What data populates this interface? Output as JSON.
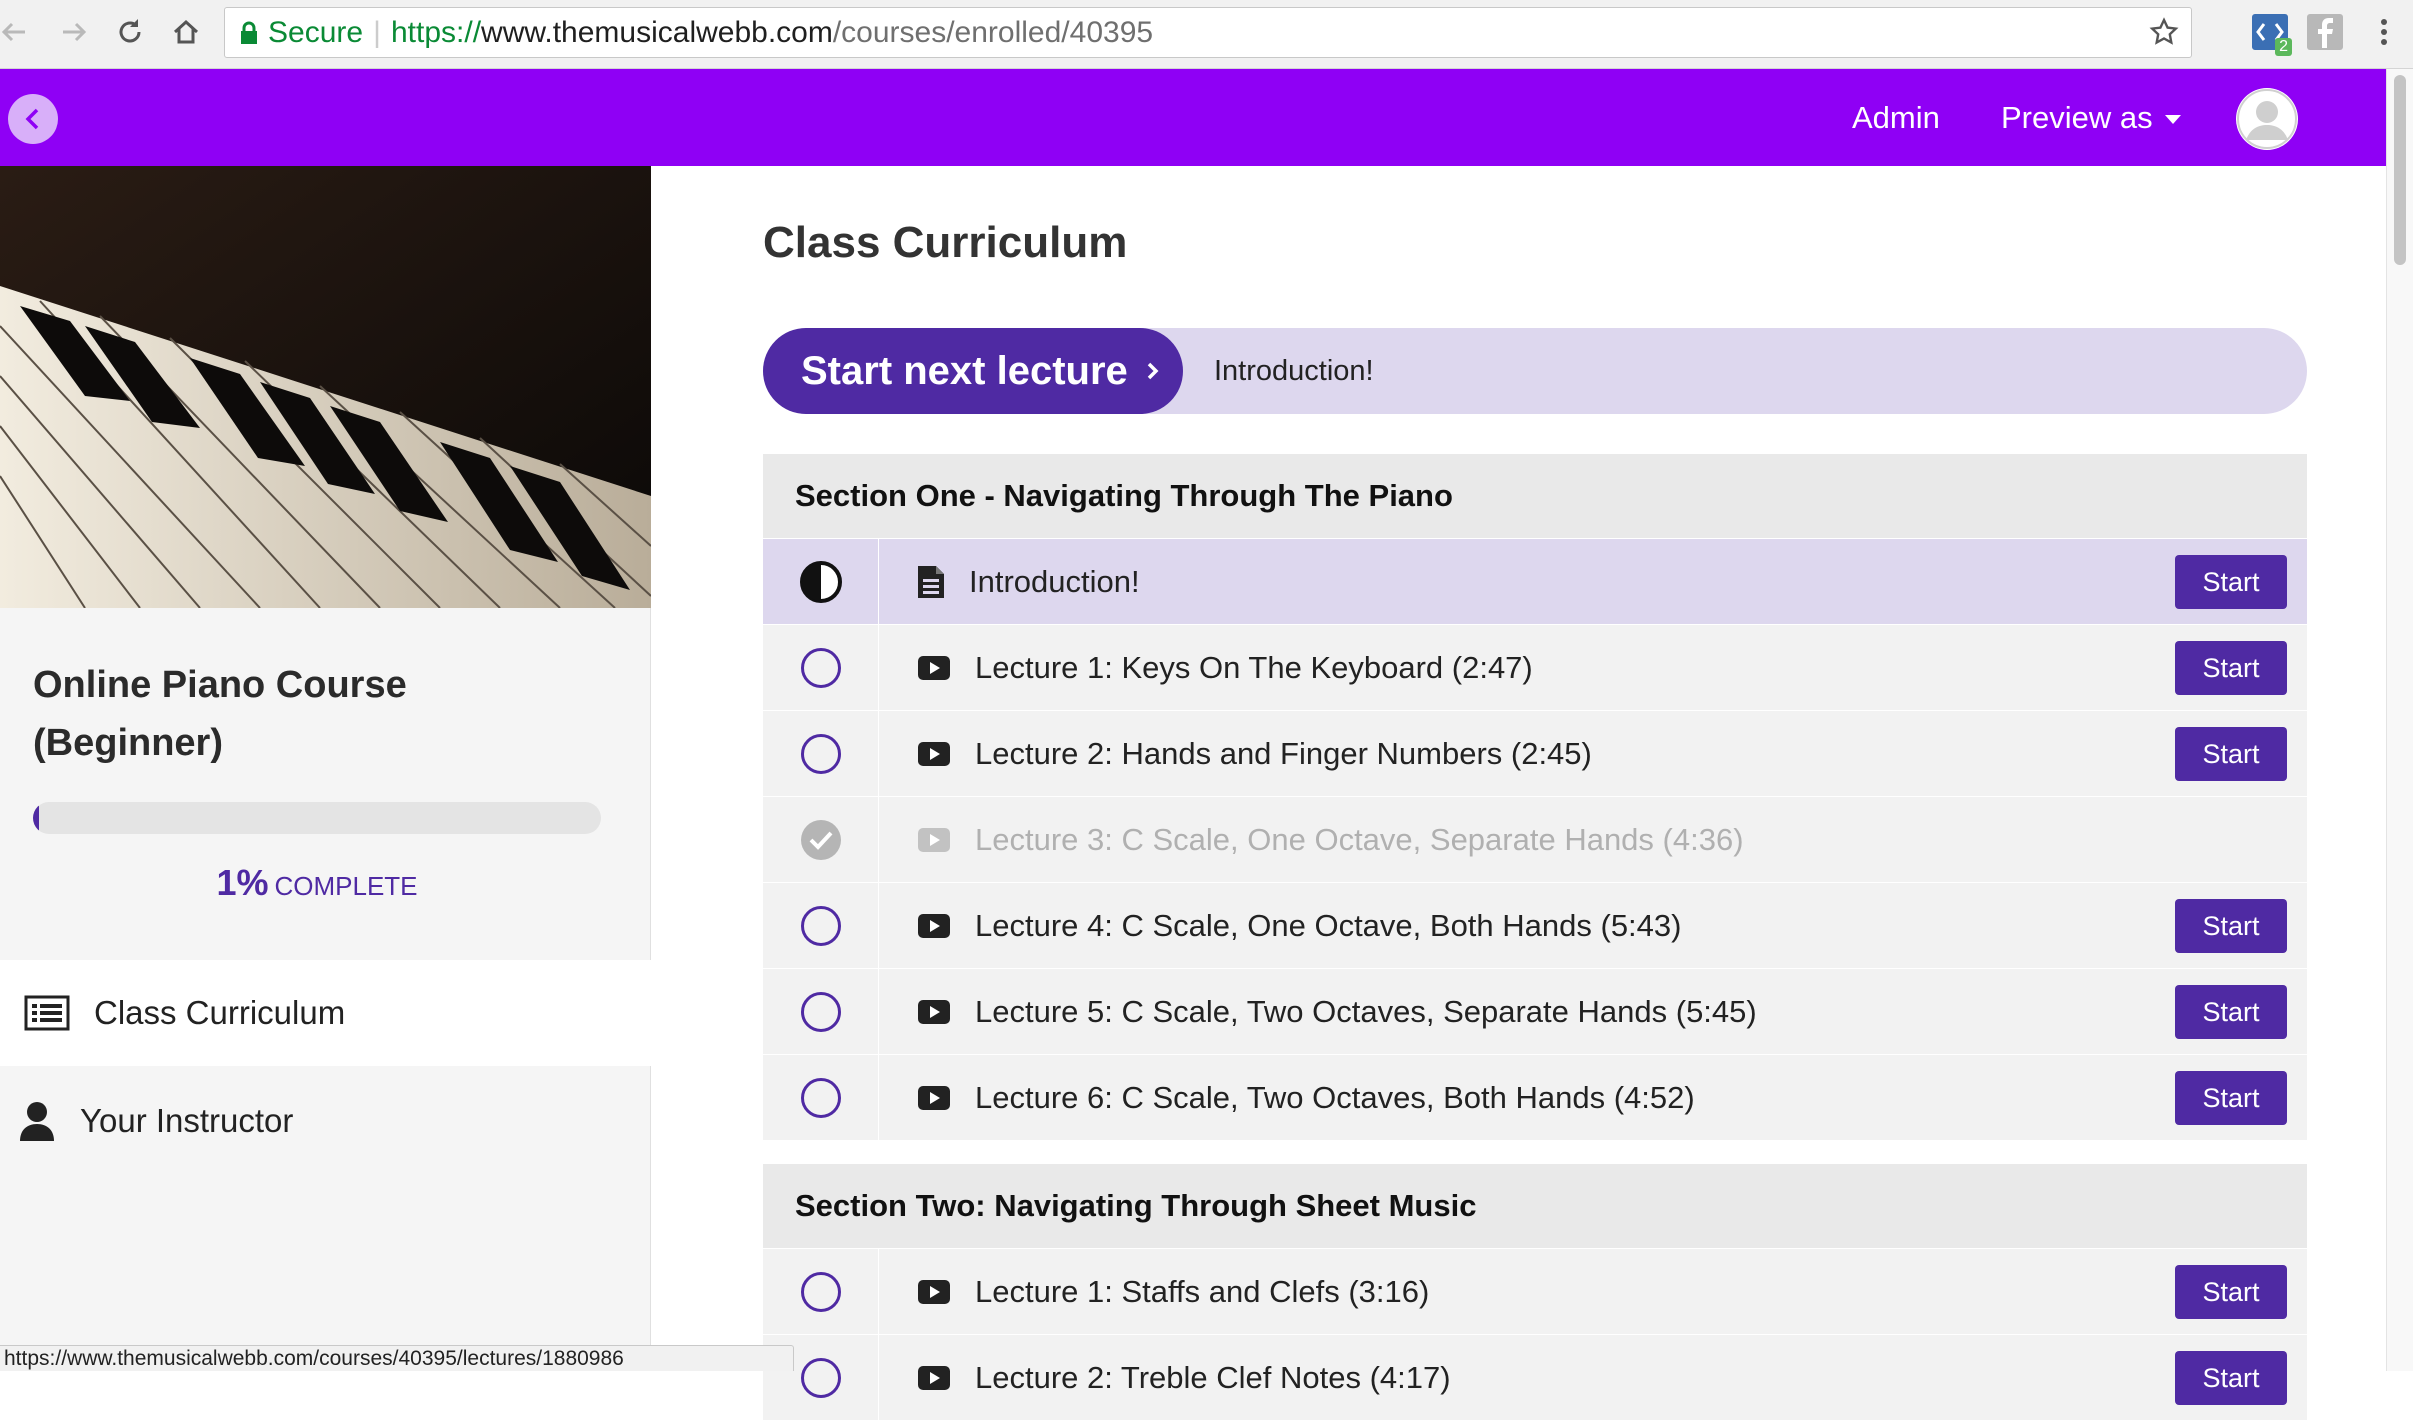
{
  "browser": {
    "secure_label": "Secure",
    "url_scheme": "https://",
    "url_host": "www.themusicalwebb.com",
    "url_path": "/courses/enrolled/40395",
    "extension_badge": "2",
    "status_url": "https://www.themusicalwebb.com/courses/40395/lectures/1880986"
  },
  "topbar": {
    "admin_label": "Admin",
    "preview_label": "Preview as",
    "accent_color": "#8f00f5"
  },
  "sidebar": {
    "course_title": "Online Piano Course (Beginner)",
    "progress_percent": 1,
    "progress_value": "1%",
    "progress_suffix": "COMPLETE",
    "nav": [
      {
        "label": "Class Curriculum",
        "icon": "list-icon",
        "active": true
      },
      {
        "label": "Your Instructor",
        "icon": "user-icon",
        "active": false
      }
    ]
  },
  "main": {
    "page_title": "Class Curriculum",
    "next_button_label": "Start next lecture",
    "next_lecture_title": "Introduction!",
    "brand_color": "#4f2aa3",
    "start_label": "Start",
    "sections": [
      {
        "title": "Section One - Navigating Through The Piano",
        "lectures": [
          {
            "title": "Introduction!",
            "type": "document-icon",
            "status": "in-progress"
          },
          {
            "title": "Lecture 1: Keys On The Keyboard (2:47)",
            "type": "video-icon",
            "status": "not-started"
          },
          {
            "title": "Lecture 2: Hands and Finger Numbers (2:45)",
            "type": "video-icon",
            "status": "not-started"
          },
          {
            "title": "Lecture 3: C Scale, One Octave, Separate Hands (4:36)",
            "type": "video-icon",
            "status": "completed"
          },
          {
            "title": "Lecture 4: C Scale, One Octave, Both Hands (5:43)",
            "type": "video-icon",
            "status": "not-started"
          },
          {
            "title": "Lecture 5: C Scale, Two Octaves, Separate Hands (5:45)",
            "type": "video-icon",
            "status": "not-started"
          },
          {
            "title": "Lecture 6: C Scale, Two Octaves, Both Hands (4:52)",
            "type": "video-icon",
            "status": "not-started"
          }
        ]
      },
      {
        "title": "Section Two: Navigating Through Sheet Music",
        "lectures": [
          {
            "title": "Lecture 1: Staffs and Clefs (3:16)",
            "type": "video-icon",
            "status": "not-started"
          },
          {
            "title": "Lecture 2: Treble Clef Notes (4:17)",
            "type": "video-icon",
            "status": "not-started"
          }
        ]
      }
    ]
  }
}
